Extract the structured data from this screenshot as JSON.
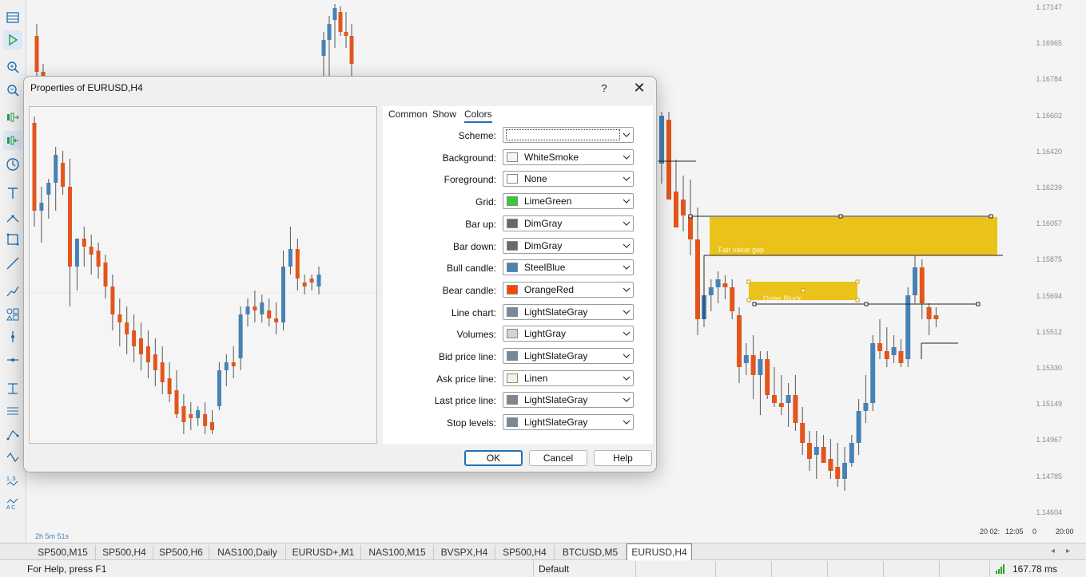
{
  "chart": {
    "price_labels": [
      "1.17147",
      "1.16965",
      "1.16784",
      "1.16602",
      "1.16420",
      "1.16239",
      "1.16057",
      "1.15875",
      "1.15694",
      "1.15512",
      "1.15330",
      "1.15149",
      "1.14967",
      "1.14785",
      "1.14604"
    ],
    "time_left": "2h 5m 51s",
    "axis_time_1": "20 02:",
    "axis_time_2": "12:05",
    "axis_time_3": "0",
    "axis_time_4": "20:00",
    "fvg_label": "Fair value gap",
    "ob_label": "Order Block",
    "colors": {
      "bull": "#4682b4",
      "bear": "#e2561c",
      "fvg": "#eac219",
      "wick": "#444444"
    }
  },
  "tabs": [
    {
      "label": "SP500,M15"
    },
    {
      "label": "SP500,H4"
    },
    {
      "label": "SP500,H6"
    },
    {
      "label": "NAS100,Daily"
    },
    {
      "label": "EURUSD+,M1"
    },
    {
      "label": "NAS100,M15"
    },
    {
      "label": "BVSPX,H4"
    },
    {
      "label": "SP500,H4"
    },
    {
      "label": "BTCUSD,M5"
    },
    {
      "label": "EURUSD,H4"
    }
  ],
  "status": {
    "help": "For Help, press F1",
    "profile": "Default",
    "ping": "167.78 ms"
  },
  "dialog": {
    "title": "Properties of EURUSD,H4",
    "help_glyph": "?",
    "close_glyph": "✕",
    "tabs": [
      "Common",
      "Show",
      "Colors"
    ],
    "active_tab": "Colors",
    "rows": [
      {
        "label": "Scheme:",
        "value": "",
        "color": ""
      },
      {
        "label": "Background:",
        "value": "WhiteSmoke",
        "color": "#f5f5f5"
      },
      {
        "label": "Foreground:",
        "value": "None",
        "color": "#ffffff"
      },
      {
        "label": "Grid:",
        "value": "LimeGreen",
        "color": "#32cd32"
      },
      {
        "label": "Bar up:",
        "value": "DimGray",
        "color": "#696969"
      },
      {
        "label": "Bar down:",
        "value": "DimGray",
        "color": "#696969"
      },
      {
        "label": "Bull candle:",
        "value": "SteelBlue",
        "color": "#4682b4"
      },
      {
        "label": "Bear candle:",
        "value": "OrangeRed",
        "color": "#ff4500"
      },
      {
        "label": "Line chart:",
        "value": "LightSlateGray",
        "color": "#778899"
      },
      {
        "label": "Volumes:",
        "value": "LightGray",
        "color": "#d3d3d3"
      },
      {
        "label": "Bid price line:",
        "value": "LightSlateGray",
        "color": "#778899"
      },
      {
        "label": "Ask price line:",
        "value": "Linen",
        "color": "#faf0e6"
      },
      {
        "label": "Last price line:",
        "value": "LightSlateGray",
        "color": "#778899"
      },
      {
        "label": "Stop levels:",
        "value": "LightSlateGray",
        "color": "#778899"
      }
    ],
    "buttons": {
      "ok": "OK",
      "cancel": "Cancel",
      "help": "Help"
    }
  },
  "toolbar_icons": [
    "market-watch-icon",
    "play-icon",
    "zoom-in-icon",
    "zoom-out-icon",
    "chart-shift-icon",
    "autoscroll-icon",
    "clock-icon",
    "text-tool-icon",
    "trendline-icon",
    "rectangle-icon",
    "line-icon",
    "polyline-icon",
    "shapes-icon",
    "vertical-line-icon",
    "horizontal-line-icon",
    "text-label-icon",
    "channel-icon",
    "pitchfork-icon",
    "wave-icon",
    "elliott-numbers-icon",
    "elliott-letters-icon"
  ]
}
